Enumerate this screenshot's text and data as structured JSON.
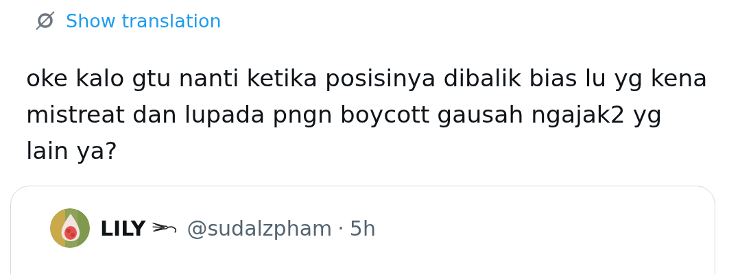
{
  "translate_link": "Show translation",
  "post": {
    "text": "oke kalo gtu nanti ketika posisinya dibalik bias lu yg kena mistreat dan lupada pngn boycott gausah ngajak2 yg lain ya?"
  },
  "quoted_post": {
    "name": "LILY",
    "handle": "@sudalzpham",
    "separator": "·",
    "time": "5h"
  }
}
